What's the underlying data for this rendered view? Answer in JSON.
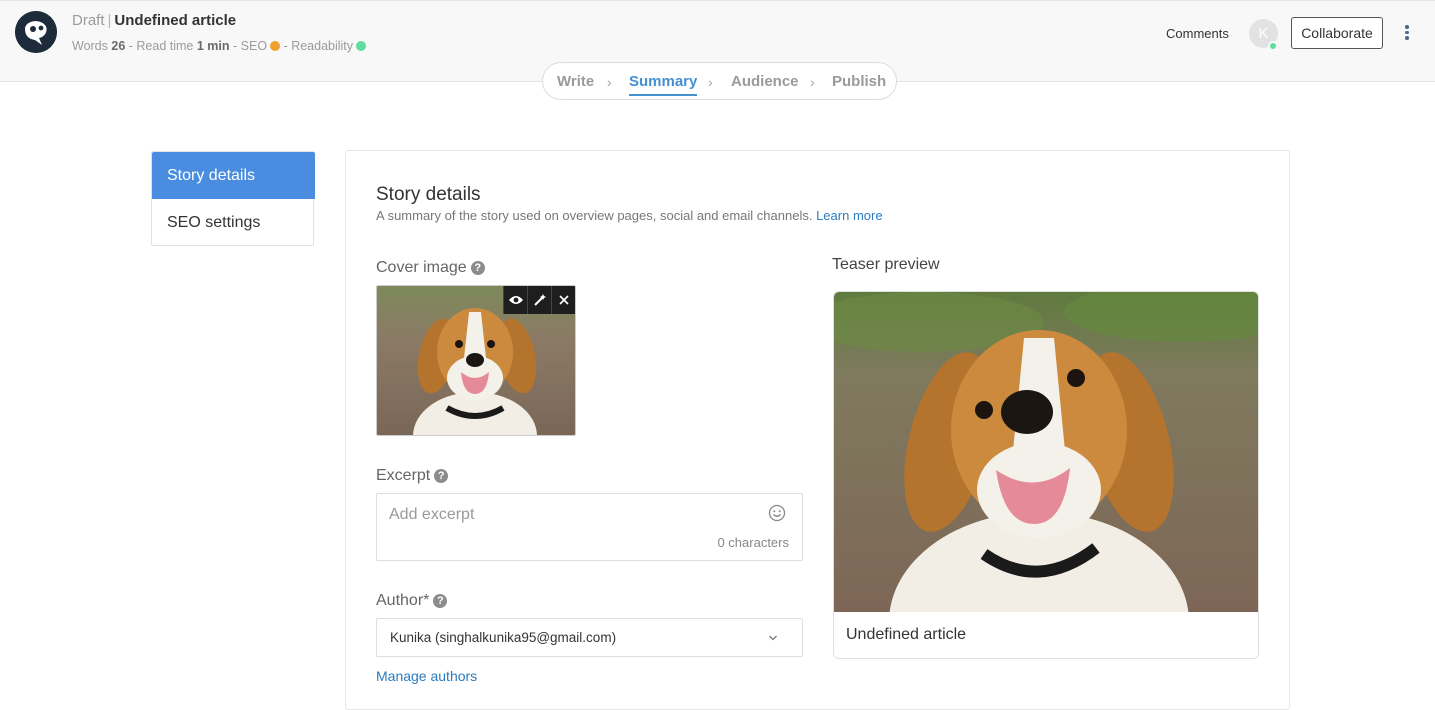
{
  "header": {
    "status": "Draft",
    "title": "Undefined article",
    "words_label": "Words",
    "words": "26",
    "read_time_label": "Read time",
    "read_time": "1 min",
    "seo_label": "SEO",
    "seo_color": "#f0a030",
    "readability_label": "Readability",
    "readability_color": "#5fdc9e",
    "comments": "Comments",
    "avatar_initial": "K",
    "collaborate": "Collaborate"
  },
  "steps": [
    {
      "label": "Write",
      "active": false
    },
    {
      "label": "Summary",
      "active": true
    },
    {
      "label": "Audience",
      "active": false
    },
    {
      "label": "Publish",
      "active": false
    }
  ],
  "sidebar": {
    "items": [
      {
        "label": "Story details",
        "active": true
      },
      {
        "label": "SEO settings",
        "active": false
      }
    ]
  },
  "story": {
    "title": "Story details",
    "description": "A summary of the story used on overview pages, social and email channels.",
    "learn_more": "Learn more",
    "cover_label": "Cover image",
    "excerpt_label": "Excerpt",
    "excerpt_placeholder": "Add excerpt",
    "excerpt_value": "",
    "char_count": "0 characters",
    "author_label": "Author*",
    "author_value": "Kunika (singhalkunika95@gmail.com)",
    "manage_authors": "Manage authors"
  },
  "teaser": {
    "label": "Teaser preview",
    "title": "Undefined article"
  },
  "accent_color": "#4a8de0"
}
